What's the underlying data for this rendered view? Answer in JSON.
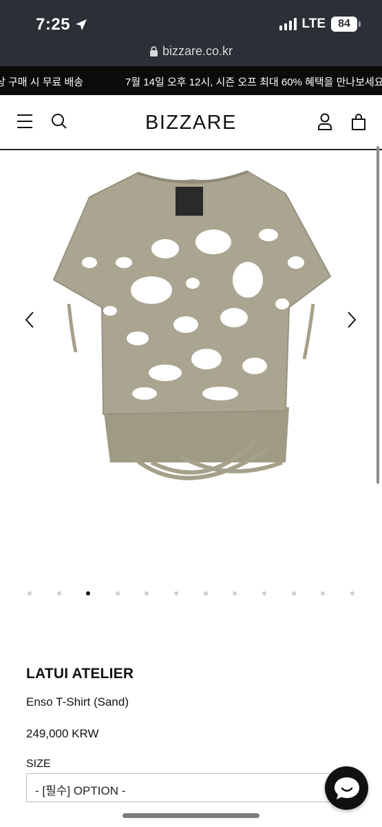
{
  "status_bar": {
    "time": "7:25",
    "network": "LTE",
    "battery": "84"
  },
  "browser": {
    "url": "bizzare.co.kr"
  },
  "announcement": {
    "left_text": "상 구매 시 무료 배송",
    "main_text": "7월 14일 오후 12시, 시즌 오프 최대 60% 혜택을 만나보세요"
  },
  "header": {
    "logo": "BIZZARE",
    "icons": [
      "menu-icon",
      "search-icon",
      "user-icon",
      "bag-icon"
    ]
  },
  "gallery": {
    "image_count": 12,
    "active_index": 2,
    "image_subject": "t-shirt"
  },
  "product": {
    "brand": "LATUI ATELIER",
    "name": "Enso T-Shirt (Sand)",
    "price": "249,000 KRW",
    "size_label": "SIZE",
    "option_value": "- [필수] OPTION -"
  },
  "colors": {
    "status_bg": "#2b2f36",
    "announcement_bg": "#0b0b0b",
    "garment": "#a9a48f"
  }
}
